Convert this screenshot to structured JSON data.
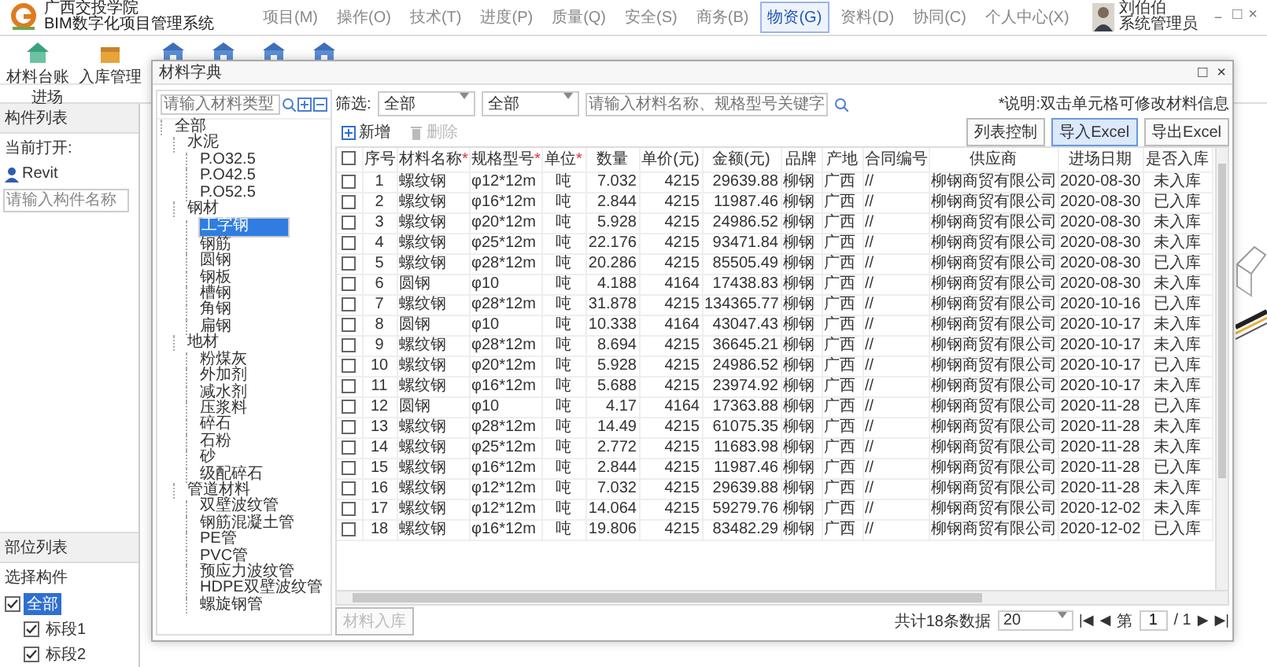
{
  "app": {
    "org": "广西交投学院",
    "system": "BIM数字化项目管理系统"
  },
  "menu": [
    {
      "label": "项目(M)",
      "selected": false
    },
    {
      "label": "操作(O)",
      "selected": false
    },
    {
      "label": "技术(T)",
      "selected": false
    },
    {
      "label": "进度(P)",
      "selected": false
    },
    {
      "label": "质量(Q)",
      "selected": false
    },
    {
      "label": "安全(S)",
      "selected": false
    },
    {
      "label": "商务(B)",
      "selected": false
    },
    {
      "label": "物资(G)",
      "selected": true
    },
    {
      "label": "资料(D)",
      "selected": false
    },
    {
      "label": "协同(C)",
      "selected": false
    },
    {
      "label": "个人中心(X)",
      "selected": false
    }
  ],
  "user": {
    "name": "刘伯伯",
    "role": "系统管理员"
  },
  "window_controls": [
    "－",
    "□",
    "×"
  ],
  "ribbon": {
    "buttons": [
      "材料台账",
      "入库管理"
    ],
    "group": "进场"
  },
  "component_panel": {
    "title": "构件列表",
    "open_label": "当前打开:",
    "file_value": "Revit",
    "search": {
      "placeholder": "请输入构件名称"
    }
  },
  "location_panel": {
    "title": "部位列表",
    "subtitle": "选择构件",
    "tree": [
      {
        "label": "全部",
        "checked": true,
        "selected": true,
        "children": [
          {
            "label": "标段1",
            "checked": true,
            "selected": false
          },
          {
            "label": "标段2",
            "checked": true,
            "selected": false
          }
        ]
      }
    ]
  },
  "dialog": {
    "title": "材料字典",
    "controls": [
      "□",
      "×"
    ],
    "category_search": {
      "placeholder": "请输入材料类型"
    },
    "category_tree": [
      {
        "label": "全部",
        "selected": false,
        "children": [
          {
            "label": "水泥",
            "selected": false,
            "children": [
              {
                "label": "P.O32.5",
                "selected": false
              },
              {
                "label": "P.O42.5",
                "selected": false
              },
              {
                "label": "P.O52.5",
                "selected": false
              }
            ]
          },
          {
            "label": "钢材",
            "selected": false,
            "children": [
              {
                "label": "工字钢",
                "selected": true
              },
              {
                "label": "钢筋",
                "selected": false
              },
              {
                "label": "圆钢",
                "selected": false
              },
              {
                "label": "钢板",
                "selected": false
              },
              {
                "label": "槽钢",
                "selected": false
              },
              {
                "label": "角钢",
                "selected": false
              },
              {
                "label": "扁钢",
                "selected": false
              }
            ]
          },
          {
            "label": "地材",
            "selected": false,
            "children": [
              {
                "label": "粉煤灰",
                "selected": false
              },
              {
                "label": "外加剂",
                "selected": false
              },
              {
                "label": "减水剂",
                "selected": false
              },
              {
                "label": "压浆料",
                "selected": false
              },
              {
                "label": "碎石",
                "selected": false
              },
              {
                "label": "石粉",
                "selected": false
              },
              {
                "label": "砂",
                "selected": false
              },
              {
                "label": "级配碎石",
                "selected": false
              }
            ]
          },
          {
            "label": "管道材料",
            "selected": false,
            "children": [
              {
                "label": "双壁波纹管",
                "selected": false
              },
              {
                "label": "钢筋混凝土管",
                "selected": false
              },
              {
                "label": "PE管",
                "selected": false
              },
              {
                "label": "PVC管",
                "selected": false
              },
              {
                "label": "预应力波纹管",
                "selected": false
              },
              {
                "label": "HDPE双壁波纹管",
                "selected": false
              },
              {
                "label": "螺旋钢管",
                "selected": false
              }
            ]
          }
        ]
      }
    ],
    "filter": {
      "label": "筛选:",
      "selects": [
        "全部",
        "全部"
      ],
      "search": {
        "placeholder": "请输入材料名称、规格型号关键字"
      }
    },
    "note": "*说明:双击单元格可修改材料信息",
    "buttons": [
      {
        "label": "列表控制",
        "highlighted": false
      },
      {
        "label": "导入Excel",
        "highlighted": true
      },
      {
        "label": "导出Excel",
        "highlighted": false
      }
    ],
    "actions": [
      {
        "label": "新增",
        "kind": "add",
        "disabled": false
      },
      {
        "label": "删除",
        "kind": "delete",
        "disabled": true
      }
    ],
    "table": {
      "all_selected": false,
      "columns": [
        {
          "label": "序号"
        },
        {
          "label": "材料名称",
          "marker": "*"
        },
        {
          "label": "规格型号",
          "marker": "*"
        },
        {
          "label": "单位",
          "marker": "*"
        },
        {
          "label": "数量"
        },
        {
          "label": "单价(元)"
        },
        {
          "label": "金额(元)"
        },
        {
          "label": "品牌"
        },
        {
          "label": "产地"
        },
        {
          "label": "合同编号"
        },
        {
          "label": "供应商"
        },
        {
          "label": "进场日期"
        },
        {
          "label": "是否入库"
        }
      ],
      "rows": [
        {
          "selected": false,
          "cells": [
            "1",
            "螺纹钢",
            "φ12*12m",
            "吨",
            "7.032",
            "4215",
            "29639.88",
            "柳钢",
            "广西",
            "//",
            "柳钢商贸有限公司",
            "2020-08-30",
            "未入库"
          ]
        },
        {
          "selected": false,
          "cells": [
            "2",
            "螺纹钢",
            "φ16*12m",
            "吨",
            "2.844",
            "4215",
            "11987.46",
            "柳钢",
            "广西",
            "//",
            "柳钢商贸有限公司",
            "2020-08-30",
            "已入库"
          ]
        },
        {
          "selected": false,
          "cells": [
            "3",
            "螺纹钢",
            "φ20*12m",
            "吨",
            "5.928",
            "4215",
            "24986.52",
            "柳钢",
            "广西",
            "//",
            "柳钢商贸有限公司",
            "2020-08-30",
            "未入库"
          ]
        },
        {
          "selected": false,
          "cells": [
            "4",
            "螺纹钢",
            "φ25*12m",
            "吨",
            "22.176",
            "4215",
            "93471.84",
            "柳钢",
            "广西",
            "//",
            "柳钢商贸有限公司",
            "2020-08-30",
            "未入库"
          ]
        },
        {
          "selected": false,
          "cells": [
            "5",
            "螺纹钢",
            "φ28*12m",
            "吨",
            "20.286",
            "4215",
            "85505.49",
            "柳钢",
            "广西",
            "//",
            "柳钢商贸有限公司",
            "2020-08-30",
            "已入库"
          ]
        },
        {
          "selected": false,
          "cells": [
            "6",
            "圆钢",
            "φ10",
            "吨",
            "4.188",
            "4164",
            "17438.83",
            "柳钢",
            "广西",
            "//",
            "柳钢商贸有限公司",
            "2020-08-30",
            "未入库"
          ]
        },
        {
          "selected": false,
          "cells": [
            "7",
            "螺纹钢",
            "φ28*12m",
            "吨",
            "31.878",
            "4215",
            "134365.77",
            "柳钢",
            "广西",
            "//",
            "柳钢商贸有限公司",
            "2020-10-16",
            "已入库"
          ]
        },
        {
          "selected": false,
          "cells": [
            "8",
            "圆钢",
            "φ10",
            "吨",
            "10.338",
            "4164",
            "43047.43",
            "柳钢",
            "广西",
            "//",
            "柳钢商贸有限公司",
            "2020-10-17",
            "未入库"
          ]
        },
        {
          "selected": false,
          "cells": [
            "9",
            "螺纹钢",
            "φ28*12m",
            "吨",
            "8.694",
            "4215",
            "36645.21",
            "柳钢",
            "广西",
            "//",
            "柳钢商贸有限公司",
            "2020-10-17",
            "未入库"
          ]
        },
        {
          "selected": false,
          "cells": [
            "10",
            "螺纹钢",
            "φ20*12m",
            "吨",
            "5.928",
            "4215",
            "24986.52",
            "柳钢",
            "广西",
            "//",
            "柳钢商贸有限公司",
            "2020-10-17",
            "已入库"
          ]
        },
        {
          "selected": false,
          "cells": [
            "11",
            "螺纹钢",
            "φ16*12m",
            "吨",
            "5.688",
            "4215",
            "23974.92",
            "柳钢",
            "广西",
            "//",
            "柳钢商贸有限公司",
            "2020-10-17",
            "未入库"
          ]
        },
        {
          "selected": false,
          "cells": [
            "12",
            "圆钢",
            "φ10",
            "吨",
            "4.17",
            "4164",
            "17363.88",
            "柳钢",
            "广西",
            "//",
            "柳钢商贸有限公司",
            "2020-11-28",
            "已入库"
          ]
        },
        {
          "selected": false,
          "cells": [
            "13",
            "螺纹钢",
            "φ28*12m",
            "吨",
            "14.49",
            "4215",
            "61075.35",
            "柳钢",
            "广西",
            "//",
            "柳钢商贸有限公司",
            "2020-11-28",
            "未入库"
          ]
        },
        {
          "selected": false,
          "cells": [
            "14",
            "螺纹钢",
            "φ25*12m",
            "吨",
            "2.772",
            "4215",
            "11683.98",
            "柳钢",
            "广西",
            "//",
            "柳钢商贸有限公司",
            "2020-11-28",
            "未入库"
          ]
        },
        {
          "selected": false,
          "cells": [
            "15",
            "螺纹钢",
            "φ16*12m",
            "吨",
            "2.844",
            "4215",
            "11987.46",
            "柳钢",
            "广西",
            "//",
            "柳钢商贸有限公司",
            "2020-11-28",
            "已入库"
          ]
        },
        {
          "selected": false,
          "cells": [
            "16",
            "螺纹钢",
            "φ12*12m",
            "吨",
            "7.032",
            "4215",
            "29639.88",
            "柳钢",
            "广西",
            "//",
            "柳钢商贸有限公司",
            "2020-11-28",
            "未入库"
          ]
        },
        {
          "selected": false,
          "cells": [
            "17",
            "螺纹钢",
            "φ12*12m",
            "吨",
            "14.064",
            "4215",
            "59279.76",
            "柳钢",
            "广西",
            "//",
            "柳钢商贸有限公司",
            "2020-12-02",
            "未入库"
          ]
        },
        {
          "selected": false,
          "cells": [
            "18",
            "螺纹钢",
            "φ16*12m",
            "吨",
            "19.806",
            "4215",
            "83482.29",
            "柳钢",
            "广西",
            "//",
            "柳钢商贸有限公司",
            "2020-12-02",
            "已入库"
          ]
        }
      ]
    },
    "footer": {
      "button": {
        "label": "材料入库",
        "disabled": true
      },
      "total": "共计18条数据",
      "page_size": "20",
      "first": "|◀",
      "prev": "◀",
      "page_label": "第",
      "page": "1",
      "page_count": "/ 1",
      "next": "▶",
      "last": "▶|"
    }
  }
}
